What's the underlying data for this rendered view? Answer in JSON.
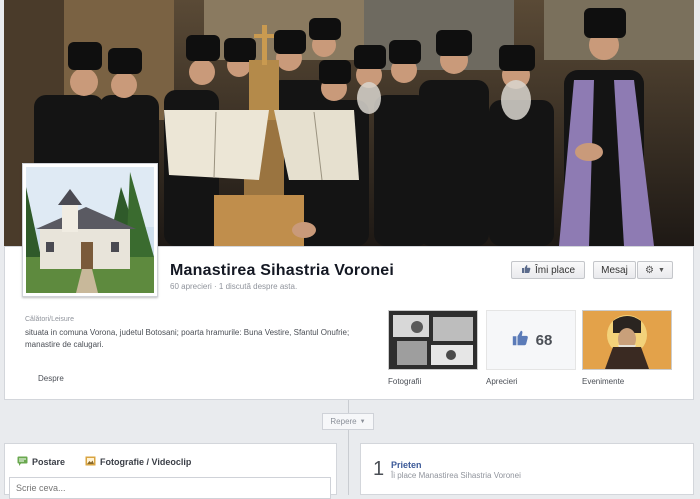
{
  "page": {
    "name": "Manastirea Sihastria Voronei",
    "stats": "60 aprecieri · 1 discută despre asta.",
    "category": "Călători/Leisure",
    "description": "situata in comuna Vorona, judetul Botosani; poarta hramurile: Buna Vestire, Sfantul Onufrie; manastire de calugari.",
    "about_label": "Despre"
  },
  "actions": {
    "like_label": "Îmi place",
    "message_label": "Mesaj"
  },
  "apps": {
    "photos_label": "Fotografii",
    "likes_label": "Aprecieri",
    "likes_count": "68",
    "events_label": "Evenimente"
  },
  "timeline": {
    "repere_label": "Repere"
  },
  "composer": {
    "post_label": "Postare",
    "photo_label": "Fotografie / Videoclip",
    "placeholder": "Scrie ceva..."
  },
  "friends": {
    "count": "1",
    "title": "Prieten",
    "subtitle": "Îi place Manastirea Sihastria Voronei"
  },
  "colors": {
    "link_blue": "#3b5998",
    "background": "#e9ebee",
    "cover_dark": "#2a231d"
  }
}
